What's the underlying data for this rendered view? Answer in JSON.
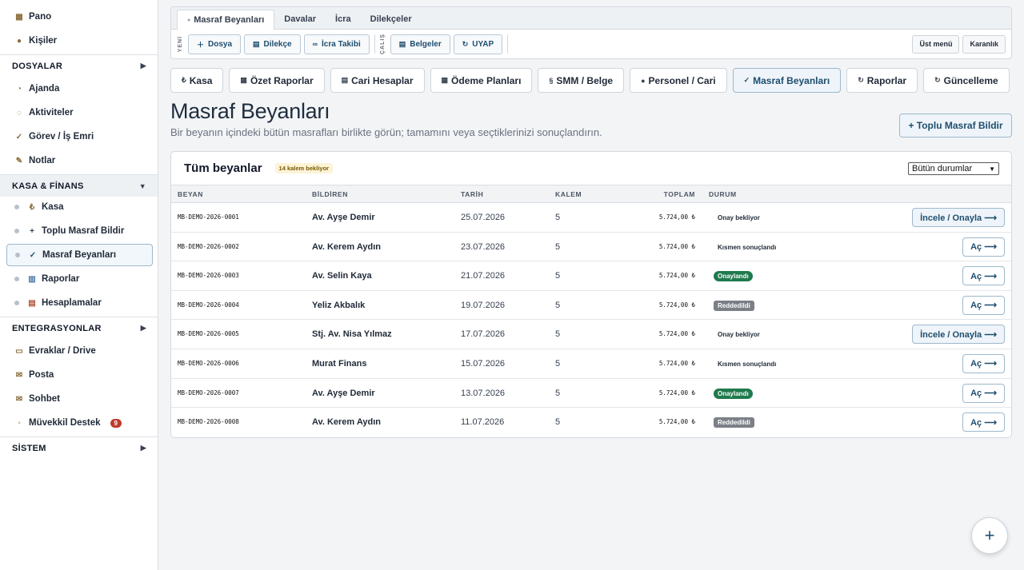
{
  "sidebar": {
    "top_items": [
      {
        "label": "Pano",
        "icon": "grid-icon"
      },
      {
        "label": "Kişiler",
        "icon": "people-icon"
      }
    ],
    "sections": [
      {
        "label": "DOSYALAR",
        "arrow": "▶"
      },
      {
        "label": "KASA & FİNANS",
        "arrow": "▼"
      },
      {
        "label": "ENTEGRASYONLAR",
        "arrow": "▶"
      },
      {
        "label": "SİSTEM",
        "arrow": "▶"
      }
    ],
    "dosyalar_items": [
      {
        "label": "Ajanda"
      },
      {
        "label": "Aktiviteler"
      },
      {
        "label": "Görev / İş Emri"
      },
      {
        "label": "Notlar"
      }
    ],
    "finans_items": [
      {
        "label": "Kasa"
      },
      {
        "label": "Toplu Masraf Bildir"
      },
      {
        "label": "Masraf Beyanları"
      },
      {
        "label": "Raporlar"
      },
      {
        "label": "Hesaplamalar"
      }
    ],
    "entegrasyon_items": [
      {
        "label": "Evraklar / Drive"
      },
      {
        "label": "Posta"
      },
      {
        "label": "Sohbet"
      },
      {
        "label": "Müvekkil Destek",
        "badge": "9"
      }
    ]
  },
  "toolbar": {
    "tabs": [
      "Masraf Beyanları",
      "Davalar",
      "İcra",
      "Dilekçeler"
    ],
    "new_label": "YENİ",
    "work_label": "ÇALIŞ",
    "new_buttons": [
      "Dosya",
      "Dilekçe",
      "İcra Takibi"
    ],
    "work_buttons": [
      "Belgeler",
      "UYAP"
    ],
    "right_buttons": [
      "Üst menü",
      "Karanlık"
    ]
  },
  "nav": [
    "Kasa",
    "Özet Raporlar",
    "Cari Hesaplar",
    "Ödeme Planları",
    "SMM / Belge",
    "Personel / Cari",
    "Masraf Beyanları",
    "Raporlar",
    "Güncelleme"
  ],
  "page": {
    "title": "Masraf Beyanları",
    "subtitle": "Bir beyanın içindeki bütün masrafları birlikte görün; tamamını veya seçtiklerinizi sonuçlandırın.",
    "bulk_button": "+ Toplu Masraf Bildir"
  },
  "card": {
    "title": "Tüm beyanlar",
    "pending_badge": "14 kalem bekliyor",
    "filter_value": "Bütün durumlar",
    "columns": [
      "BEYAN",
      "BİLDİREN",
      "TARİH",
      "KALEM",
      "TOPLAM",
      "DURUM"
    ],
    "rows": [
      {
        "id": "MB-DEMO-2026-0001",
        "who": "Av. Ayşe Demir",
        "date": "25.07.2026",
        "count": "5",
        "total": "5.724,00 ₺",
        "status": "Onay bekliyor",
        "kind": "wait",
        "action": "İncele / Onayla ⟶"
      },
      {
        "id": "MB-DEMO-2026-0002",
        "who": "Av. Kerem Aydın",
        "date": "23.07.2026",
        "count": "5",
        "total": "5.724,00 ₺",
        "status": "Kısmen sonuçlandı",
        "kind": "part",
        "action": "Aç ⟶"
      },
      {
        "id": "MB-DEMO-2026-0003",
        "who": "Av. Selin Kaya",
        "date": "21.07.2026",
        "count": "5",
        "total": "5.724,00 ₺",
        "status": "Onaylandı",
        "kind": "ok",
        "action": "Aç ⟶"
      },
      {
        "id": "MB-DEMO-2026-0004",
        "who": "Yeliz Akbalık",
        "date": "19.07.2026",
        "count": "5",
        "total": "5.724,00 ₺",
        "status": "Reddedildi",
        "kind": "rej",
        "action": "Aç ⟶"
      },
      {
        "id": "MB-DEMO-2026-0005",
        "who": "Stj. Av. Nisa Yılmaz",
        "date": "17.07.2026",
        "count": "5",
        "total": "5.724,00 ₺",
        "status": "Onay bekliyor",
        "kind": "wait",
        "action": "İncele / Onayla ⟶"
      },
      {
        "id": "MB-DEMO-2026-0006",
        "who": "Murat Finans",
        "date": "15.07.2026",
        "count": "5",
        "total": "5.724,00 ₺",
        "status": "Kısmen sonuçlandı",
        "kind": "part",
        "action": "Aç ⟶"
      },
      {
        "id": "MB-DEMO-2026-0007",
        "who": "Av. Ayşe Demir",
        "date": "13.07.2026",
        "count": "5",
        "total": "5.724,00 ₺",
        "status": "Onaylandı",
        "kind": "ok",
        "action": "Aç ⟶"
      },
      {
        "id": "MB-DEMO-2026-0008",
        "who": "Av. Kerem Aydın",
        "date": "11.07.2026",
        "count": "5",
        "total": "5.724,00 ₺",
        "status": "Reddedildi",
        "kind": "rej",
        "action": "Aç ⟶"
      }
    ]
  },
  "fab_label": "+"
}
